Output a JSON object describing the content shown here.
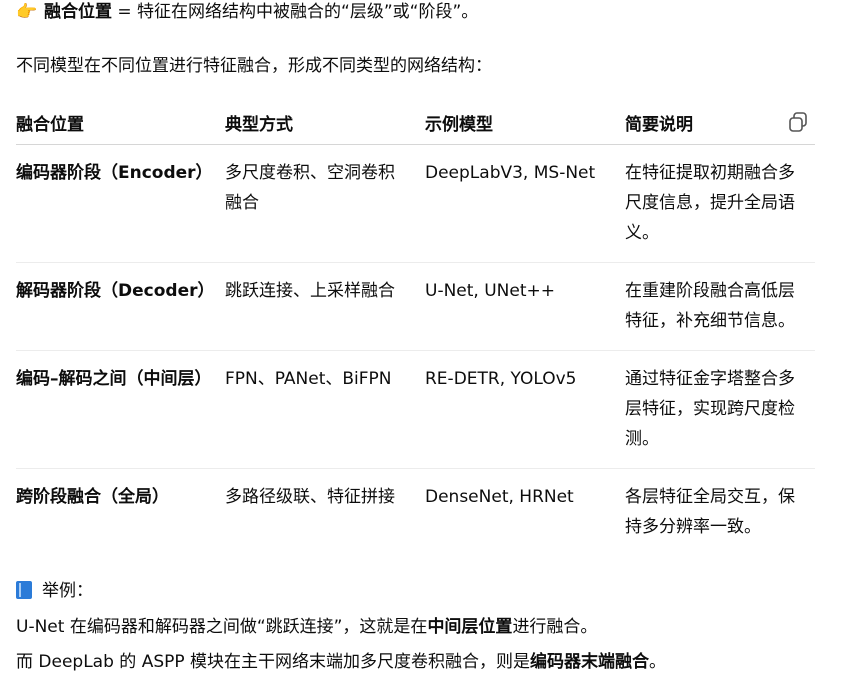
{
  "heading": {
    "emoji": "👉",
    "bold": "融合位置",
    "rest": " = 特征在网络结构中被融合的“层级”或“阶段”。"
  },
  "intro": "不同模型在不同位置进行特征融合，形成不同类型的网络结构：",
  "table": {
    "headers": [
      "融合位置",
      "典型方式",
      "示例模型",
      "简要说明"
    ],
    "rows": [
      {
        "position": "编码器阶段（Encoder）",
        "method": "多尺度卷积、空洞卷积融合",
        "models": "DeepLabV3, MS-Net",
        "desc": "在特征提取初期融合多尺度信息，提升全局语义。"
      },
      {
        "position": "解码器阶段（Decoder）",
        "method": "跳跃连接、上采样融合",
        "models": "U-Net, UNet++",
        "desc": "在重建阶段融合高低层特征，补充细节信息。"
      },
      {
        "position": "编码–解码之间（中间层）",
        "method": "FPN、PANet、BiFPN",
        "models": "RE-DETR, YOLOv5",
        "desc": "通过特征金字塔整合多层特征，实现跨尺度检测。"
      },
      {
        "position": "跨阶段融合（全局）",
        "method": "多路径级联、特征拼接",
        "models": "DenseNet, HRNet",
        "desc": "各层特征全局交互，保持多分辨率一致。"
      }
    ]
  },
  "example": {
    "label": "举例：",
    "line1": {
      "pre": "U-Net 在编码器和解码器之间做“跳跃连接”，这就是在",
      "bold": "中间层位置",
      "post": "进行融合。"
    },
    "line2": {
      "pre": "而 DeepLab 的 ASPP 模块在主干网络末端加多尺度卷积融合，则是",
      "bold": "编码器末端融合",
      "post": "。"
    }
  },
  "icons": {
    "copy": "copy-icon",
    "pointing": "backhand-index-pointing-right",
    "book": "blue-book"
  }
}
